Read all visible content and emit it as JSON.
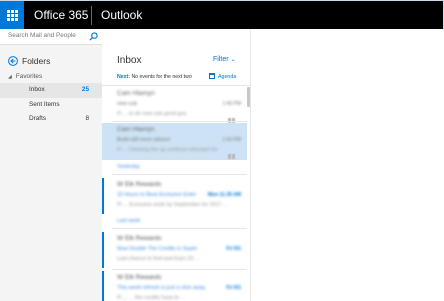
{
  "topbar": {
    "brand": "Office 365",
    "app_name": "Outlook"
  },
  "search": {
    "placeholder": "Search Mail and People"
  },
  "nav": {
    "folders_label": "Folders",
    "favorites_label": "Favorites",
    "items": [
      {
        "label": "Inbox",
        "count": "25"
      },
      {
        "label": "Sent Items",
        "count": ""
      },
      {
        "label": "Drafts",
        "count": "8"
      }
    ]
  },
  "list": {
    "title": "Inbox",
    "filter_label": "Filter",
    "next_label": "Next:",
    "next_text": "No events for the next two",
    "agenda_label": "Agenda",
    "sections": [
      "Yesterday",
      "Last week"
    ],
    "messages": [
      {
        "sender": "Cam Hlamyn",
        "subject": "new sub",
        "preview": "Fi ... to do new sub good goo",
        "time": "1:46 PM"
      },
      {
        "sender": "Cam Hlamyn",
        "subject": "Build still more advice!",
        "preview": "Fi ... Clearing the up continue reluctant fro",
        "time": "1:43 PM"
      },
      {
        "sender": "W Elk Rewards",
        "subject": "10 Hours to Beat Exclusive Enter",
        "preview": "Pi ... Exclusive ends by September for 2017 ...",
        "time": "Mon 11:35 AM"
      },
      {
        "sender": "W Elk Rewards",
        "subject": "Now Double The Credits in Super",
        "preview": "Last chance to find and Earn 2X ...",
        "time": "Fri 9/1"
      },
      {
        "sender": "W Elk Rewards",
        "subject": "This week refresh is just a click away",
        "preview": "Fi ... ... the credits have to ...",
        "time": "Fri 9/1"
      }
    ]
  },
  "colors": {
    "accent": "#0078d7",
    "topbar": "#000000",
    "selected_row": "#cde3f5",
    "nav_bg": "#f4f4f4"
  }
}
